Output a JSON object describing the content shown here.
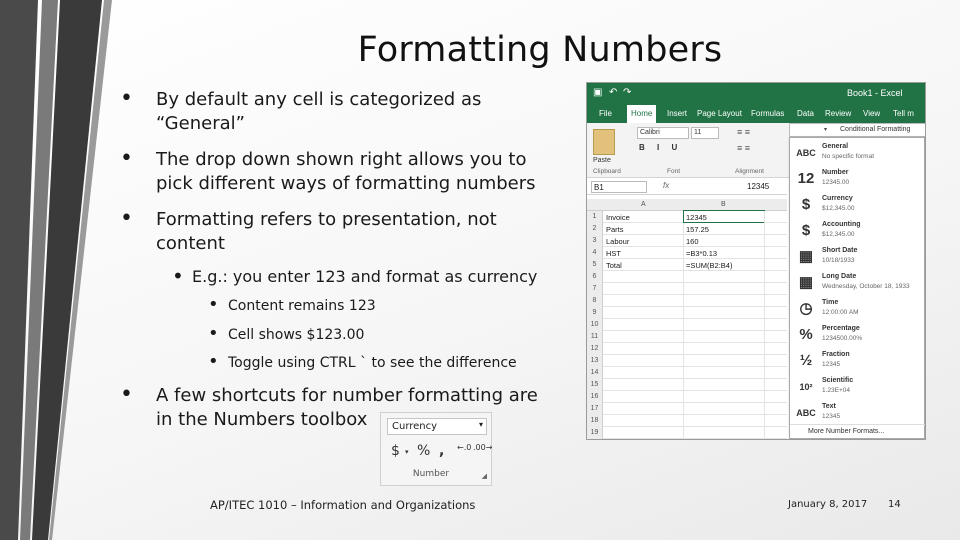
{
  "slide": {
    "title": "Formatting Numbers",
    "bullets": [
      {
        "level": 1,
        "lines": [
          "By default any cell is categorized as",
          "“General”"
        ]
      },
      {
        "level": 1,
        "lines": [
          "The drop down shown right allows you to",
          "pick different ways of formatting numbers"
        ]
      },
      {
        "level": 1,
        "lines": [
          "Formatting refers to presentation, not",
          "content"
        ]
      },
      {
        "level": 2,
        "lines": [
          "E.g.: you enter 123 and format as currency"
        ]
      },
      {
        "level": 3,
        "lines": [
          "Content remains 123"
        ]
      },
      {
        "level": 3,
        "lines": [
          "Cell shows $123.00"
        ]
      },
      {
        "level": 3,
        "lines": [
          "Toggle using CTRL ` to see the difference"
        ]
      },
      {
        "level": 1,
        "lines": [
          "A few shortcuts for number formatting are",
          "in the Numbers toolbox"
        ]
      }
    ],
    "footer": {
      "course": "AP/ITEC 1010 – Information and Organizations",
      "date": "January 8, 2017",
      "page": "14"
    },
    "accent": "#217346"
  },
  "toolbox": {
    "select_value": "Currency",
    "buttons": [
      "$",
      "%",
      ","
    ],
    "label": "Number"
  },
  "excel": {
    "window_title": "Book1 - Excel",
    "tabs": [
      "File",
      "Home",
      "Insert",
      "Page Layout",
      "Formulas",
      "Data",
      "Review",
      "View",
      "Tell m"
    ],
    "active_tab": "Home",
    "font_name": "Calibri",
    "font_size": "11",
    "paste_label": "Paste",
    "groups": [
      "Clipboard",
      "Font",
      "Alignment"
    ],
    "name_box": "B1",
    "formula_value": "12345",
    "columns": [
      "A",
      "B"
    ],
    "rows": [
      {
        "n": "1",
        "a": "Invoice",
        "b": "12345"
      },
      {
        "n": "2",
        "a": "Parts",
        "b": "157.25"
      },
      {
        "n": "3",
        "a": "Labour",
        "b": "160"
      },
      {
        "n": "4",
        "a": "HST",
        "b": "=B3*0.13"
      },
      {
        "n": "5",
        "a": "Total",
        "b": "=SUM(B2:B4)"
      },
      {
        "n": "6",
        "a": "",
        "b": ""
      },
      {
        "n": "7",
        "a": "",
        "b": ""
      },
      {
        "n": "8",
        "a": "",
        "b": ""
      },
      {
        "n": "9",
        "a": "",
        "b": ""
      },
      {
        "n": "10",
        "a": "",
        "b": ""
      },
      {
        "n": "11",
        "a": "",
        "b": ""
      },
      {
        "n": "12",
        "a": "",
        "b": ""
      },
      {
        "n": "13",
        "a": "",
        "b": ""
      },
      {
        "n": "14",
        "a": "",
        "b": ""
      },
      {
        "n": "15",
        "a": "",
        "b": ""
      },
      {
        "n": "16",
        "a": "",
        "b": ""
      },
      {
        "n": "17",
        "a": "",
        "b": ""
      },
      {
        "n": "18",
        "a": "",
        "b": ""
      },
      {
        "n": "19",
        "a": "",
        "b": ""
      }
    ],
    "conditional_formatting": "Conditional Formatting",
    "formats": [
      {
        "name": "General",
        "example": "No specific format",
        "icon": "ABC"
      },
      {
        "name": "Number",
        "example": "12345.00",
        "icon": "12"
      },
      {
        "name": "Currency",
        "example": "$12,345.00",
        "icon": "$"
      },
      {
        "name": "Accounting",
        "example": "$12,345.00",
        "icon": "$"
      },
      {
        "name": "Short Date",
        "example": "10/18/1933",
        "icon": "▦"
      },
      {
        "name": "Long Date",
        "example": "Wednesday, October 18, 1933",
        "icon": "▦"
      },
      {
        "name": "Time",
        "example": "12:00:00 AM",
        "icon": "◷"
      },
      {
        "name": "Percentage",
        "example": "1234500.00%",
        "icon": "%"
      },
      {
        "name": "Fraction",
        "example": "12345",
        "icon": "½"
      },
      {
        "name": "Scientific",
        "example": "1.23E+04",
        "icon": "10²"
      },
      {
        "name": "Text",
        "example": "12345",
        "icon": "ABC"
      }
    ],
    "more_formats": "More Number Formats..."
  }
}
